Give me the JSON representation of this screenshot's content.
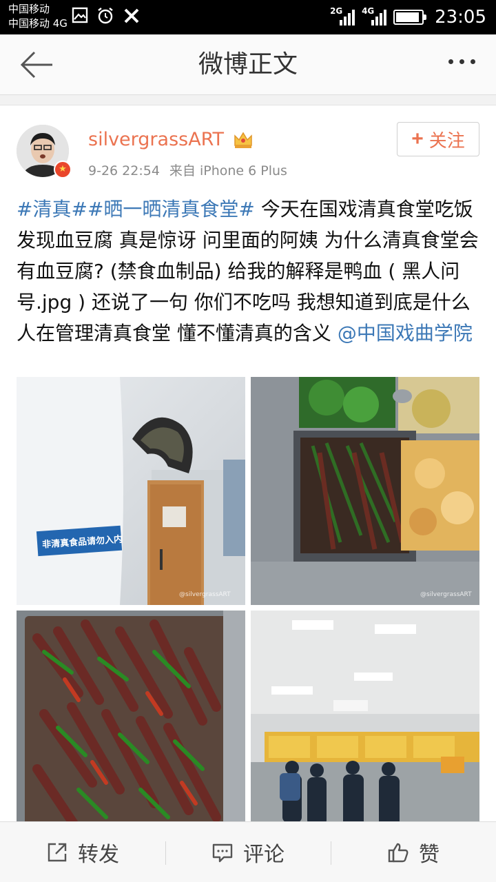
{
  "status_bar": {
    "carrier_1": "中国移动",
    "carrier_2": "中国移动 4G",
    "network_1": "2G",
    "network_2": "4G",
    "time": "23:05"
  },
  "nav": {
    "title": "微博正文",
    "back_icon": "back-arrow-icon",
    "more_icon": "more-dots-icon"
  },
  "post": {
    "author": "silvergrassART",
    "timestamp": "9-26 22:54",
    "source": "来自 iPhone 6 Plus",
    "follow_label": "关注",
    "tag_1": "#清真#",
    "tag_2": "#晒一晒清真食堂#",
    "body": " 今天在国戏清真食堂吃饭 发现血豆腐 真是惊讶 问里面的阿姨 为什么清真食堂会有血豆腐? (禁食血制品) 给我的解释是鸭血 ( 黑人问号.jpg ) 还说了一句 你们不吃吗 我想知道到底是什么人在管理清真食堂 懂不懂清真的含义 ",
    "mention": "@中国戏曲学院",
    "photo_1_sign": "非清真食品请勿入内",
    "photo_watermark": "@silvergrassART",
    "photo_watermark_url": "weibo.com/2076665323"
  },
  "actions": {
    "repost": "转发",
    "comment": "评论",
    "like": "赞"
  },
  "colors": {
    "accent": "#eb7350",
    "link": "#3c78b6"
  }
}
